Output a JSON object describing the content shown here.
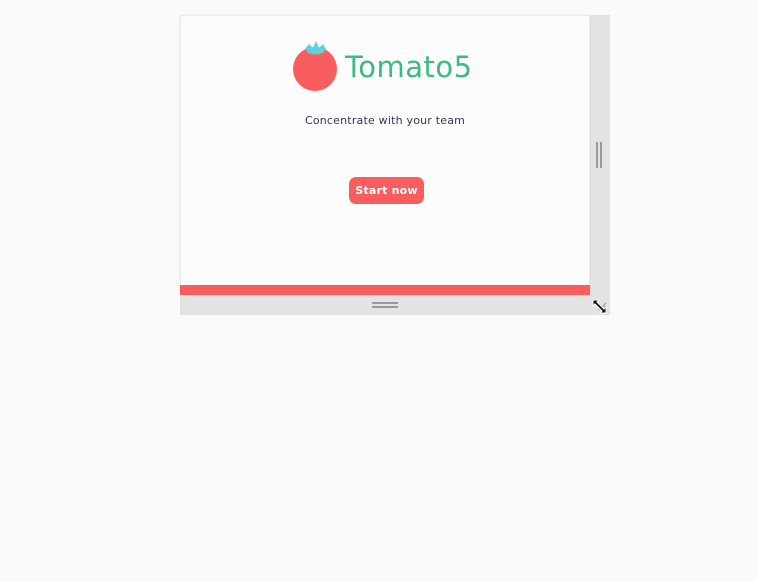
{
  "app": {
    "title": "Tomato5",
    "tagline": "Concentrate with your team"
  },
  "actions": {
    "start_label": "Start now"
  },
  "icons": {
    "logo": "tomato-icon",
    "resize_right": "vertical-resize-grip-icon",
    "resize_bottom": "horizontal-resize-grip-icon",
    "resize_corner": "diagonal-resize-cursor-icon"
  },
  "colors": {
    "brand_green": "#3dba7e",
    "accent_red": "#fa5d5d",
    "leaf_teal": "#5fcfdc",
    "text_dark": "#34365a",
    "frame_grey": "#e3e3e3",
    "background": "#fafafa"
  }
}
